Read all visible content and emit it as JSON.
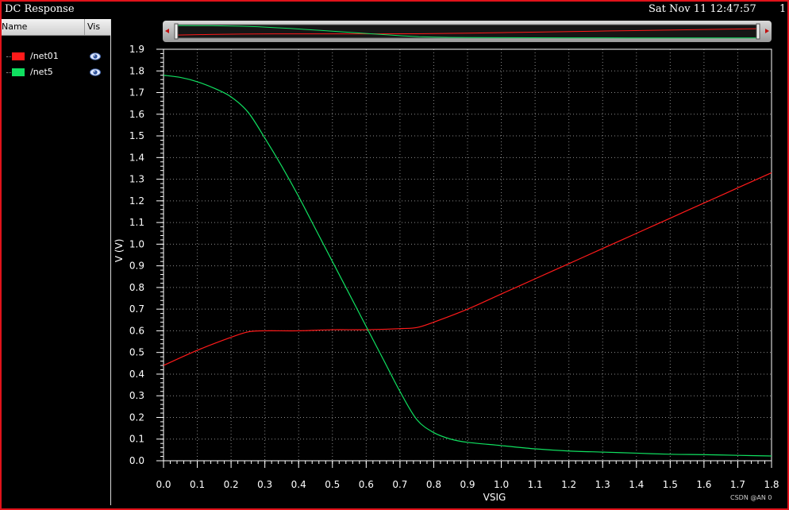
{
  "window": {
    "title": "DC Response",
    "timestamp": "Sat Nov 11 12:47:57",
    "page": "1"
  },
  "legend": {
    "header_name": "Name",
    "header_vis": "Vis",
    "items": [
      {
        "label": "/net01",
        "color": "#ff1a1a",
        "icon": "eye-icon"
      },
      {
        "label": "/net5",
        "color": "#10e060",
        "icon": "eye-icon"
      }
    ]
  },
  "colors": {
    "frame": "#e0121a",
    "background": "#000000",
    "grid": "#8a8a8a"
  },
  "watermark": "CSDN @AN 0",
  "chart_data": {
    "type": "line",
    "title": "",
    "xlabel": "VSIG",
    "ylabel": "V (V)",
    "xlim": [
      0.0,
      1.8
    ],
    "ylim": [
      0.0,
      1.9
    ],
    "xticks": [
      "0.0",
      "0.1",
      "0.2",
      "0.3",
      "0.4",
      "0.5",
      "0.6",
      "0.7",
      "0.8",
      "0.9",
      "1.0",
      "1.1",
      "1.2",
      "1.3",
      "1.4",
      "1.5",
      "1.6",
      "1.7",
      "1.8"
    ],
    "yticks": [
      "0.0",
      "0.1",
      "0.2",
      "0.3",
      "0.4",
      "0.5",
      "0.6",
      "0.7",
      "0.8",
      "0.9",
      "1.0",
      "1.1",
      "1.2",
      "1.3",
      "1.4",
      "1.5",
      "1.6",
      "1.7",
      "1.8",
      "1.9"
    ],
    "grid": true,
    "series": [
      {
        "name": "/net01",
        "color": "#ff1a1a",
        "x": [
          0.0,
          0.1,
          0.2,
          0.25,
          0.3,
          0.4,
          0.5,
          0.6,
          0.7,
          0.75,
          0.8,
          0.9,
          1.0,
          1.1,
          1.2,
          1.3,
          1.4,
          1.5,
          1.6,
          1.7,
          1.8
        ],
        "y": [
          0.44,
          0.51,
          0.57,
          0.595,
          0.6,
          0.6,
          0.605,
          0.605,
          0.61,
          0.615,
          0.64,
          0.7,
          0.77,
          0.84,
          0.91,
          0.98,
          1.05,
          1.12,
          1.19,
          1.26,
          1.33
        ]
      },
      {
        "name": "/net5",
        "color": "#10e060",
        "x": [
          0.0,
          0.05,
          0.1,
          0.15,
          0.2,
          0.25,
          0.3,
          0.35,
          0.4,
          0.45,
          0.5,
          0.55,
          0.6,
          0.65,
          0.7,
          0.75,
          0.8,
          0.85,
          0.9,
          1.0,
          1.1,
          1.2,
          1.3,
          1.4,
          1.5,
          1.6,
          1.7,
          1.8
        ],
        "y": [
          1.78,
          1.77,
          1.75,
          1.72,
          1.68,
          1.61,
          1.49,
          1.36,
          1.22,
          1.07,
          0.92,
          0.77,
          0.62,
          0.47,
          0.32,
          0.19,
          0.13,
          0.1,
          0.085,
          0.07,
          0.055,
          0.045,
          0.04,
          0.035,
          0.03,
          0.028,
          0.025,
          0.022
        ]
      }
    ]
  }
}
